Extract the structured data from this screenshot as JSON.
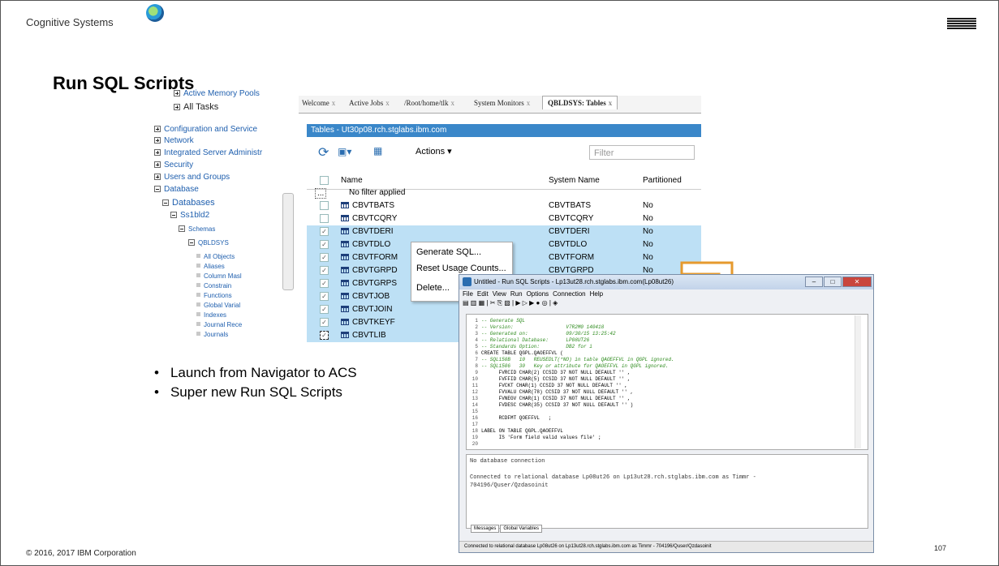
{
  "header": {
    "brand": "Cognitive Systems",
    "company_logo": "IBM",
    "title": "Run SQL Scripts"
  },
  "navigator": {
    "items": [
      {
        "label": "Active Memory Pools",
        "kind": "plus"
      },
      {
        "label": "All Tasks",
        "kind": "plus"
      },
      {
        "label": "Configuration and Service",
        "kind": "plus"
      },
      {
        "label": "Network",
        "kind": "plus"
      },
      {
        "label": "Integrated Server Administr",
        "kind": "plus"
      },
      {
        "label": "Security",
        "kind": "plus"
      },
      {
        "label": "Users and Groups",
        "kind": "plus"
      },
      {
        "label": "Database",
        "kind": "minus"
      },
      {
        "label": "Databases",
        "kind": "minus"
      },
      {
        "label": "Ss1bld2",
        "kind": "minus"
      },
      {
        "label": "Schemas",
        "kind": "minus"
      },
      {
        "label": "QBLDSYS",
        "kind": "minus"
      },
      {
        "label": "All Objects",
        "kind": "leaf"
      },
      {
        "label": "Aliases",
        "kind": "leaf"
      },
      {
        "label": "Column Masl",
        "kind": "leaf"
      },
      {
        "label": "Constrain",
        "kind": "leaf"
      },
      {
        "label": "Functions",
        "kind": "leaf"
      },
      {
        "label": "Global Varial",
        "kind": "leaf"
      },
      {
        "label": "Indexes",
        "kind": "leaf"
      },
      {
        "label": "Journal Rece",
        "kind": "leaf"
      },
      {
        "label": "Journals",
        "kind": "leaf"
      }
    ]
  },
  "tabs": [
    {
      "label": "Welcome",
      "close": "x"
    },
    {
      "label": "Active Jobs",
      "close": "x"
    },
    {
      "label": "/Root/home/tlk",
      "close": "x"
    },
    {
      "label": "System Monitors",
      "close": "x"
    },
    {
      "label": "QBLDSYS: Tables",
      "close": "x"
    }
  ],
  "tables_panel": {
    "title": "Tables - Ut30p08.rch.stglabs.ibm.com",
    "actions_label": "Actions",
    "filter_placeholder": "Filter",
    "columns": {
      "name": "Name",
      "system_name": "System Name",
      "partitioned": "Partitioned"
    },
    "filter_row": "No filter applied",
    "filter_row_icon": "...",
    "rows": [
      {
        "name": "CBVTBATS",
        "system": "CBVTBATS",
        "part": "No",
        "checked": false
      },
      {
        "name": "CBVTCQRY",
        "system": "CBVTCQRY",
        "part": "No",
        "checked": false
      },
      {
        "name": "CBVTDERI",
        "system": "CBVTDERI",
        "part": "No",
        "checked": true
      },
      {
        "name": "CBVTDLO",
        "system": "CBVTDLO",
        "part": "No",
        "checked": true
      },
      {
        "name": "CBVTFORM",
        "system": "CBVTFORM",
        "part": "No",
        "checked": true
      },
      {
        "name": "CBVTGRPD",
        "system": "CBVTGRPD",
        "part": "No",
        "checked": true
      },
      {
        "name": "CBVTGRPS",
        "system": "",
        "part": "",
        "checked": true
      },
      {
        "name": "CBVTJOB",
        "system": "",
        "part": "",
        "checked": true
      },
      {
        "name": "CBVTJOIN",
        "system": "",
        "part": "",
        "checked": true
      },
      {
        "name": "CBVTKEYF",
        "system": "",
        "part": "",
        "checked": true
      },
      {
        "name": "CBVTLIB",
        "system": "",
        "part": "",
        "checked": true
      }
    ]
  },
  "context_menu": [
    "Generate SQL...",
    "Reset Usage Counts...",
    "Delete..."
  ],
  "bullets": [
    "Launch from Navigator to ACS",
    "Super new Run SQL Scripts"
  ],
  "sql_window": {
    "title": "Untitled - Run SQL Scripts - Lp13ut28.rch.stglabs.ibm.com(Lp08ut26)",
    "menu": [
      "File",
      "Edit",
      "View",
      "Run",
      "Options",
      "Connection",
      "Help"
    ],
    "code_lines": [
      "-- Generate SQL",
      "-- Version:                  V7R2M0 140418",
      "-- Generated on:             09/30/15 13:25:42",
      "-- Relational Database:      LP08UT26",
      "-- Standards Option:         DB2 for i",
      "CREATE TABLE QGPL.QAOEFFVL (",
      "-- SQL150B   10   REUSEDLT(*NO) in table QAOEFFVL in QGPL ignored.",
      "-- SQL1506   30   Key or attribute for QAOEFFVL in QGPL ignored.",
      "      FVRCID CHAR(2) CCSID 37 NOT NULL DEFAULT '' ,",
      "      FVFFID CHAR(5) CCSID 37 NOT NULL DEFAULT '' ,",
      "      FVCKT CHAR(1) CCSID 37 NOT NULL DEFAULT '' ,",
      "      FVVALU CHAR(78) CCSID 37 NOT NULL DEFAULT '' ,",
      "      FVNEGV CHAR(1) CCSID 37 NOT NULL DEFAULT '' ,",
      "      FVDESC CHAR(35) CCSID 37 NOT NULL DEFAULT '' )",
      "",
      "      RCDFMT QOEFFVL   ;",
      "",
      "LABEL ON TABLE QGPL.QAOEFFVL",
      "      IS 'Form field valid values file' ;",
      ""
    ],
    "messages": [
      "No database connection",
      "",
      "Connected to relational database Lp08ut26 on Lp13ut28.rch.stglabs.ibm.com as Timmr -",
      "704196/Quser/Qzdasoinit"
    ],
    "message_tabs": [
      "Messages",
      "Global Variables"
    ],
    "status": "Connected to relational database Lp08ut26 on Lp13ut28.rch.stglabs.ibm.com as Timmr - 704196/Quser/Qzdasoinit"
  },
  "footer": {
    "copyright": "© 2016, 2017 IBM Corporation",
    "page_number": "107"
  },
  "colors": {
    "accent_blue": "#3a87c9",
    "selection": "#bde0f5",
    "arrow": "#e69a2e"
  }
}
